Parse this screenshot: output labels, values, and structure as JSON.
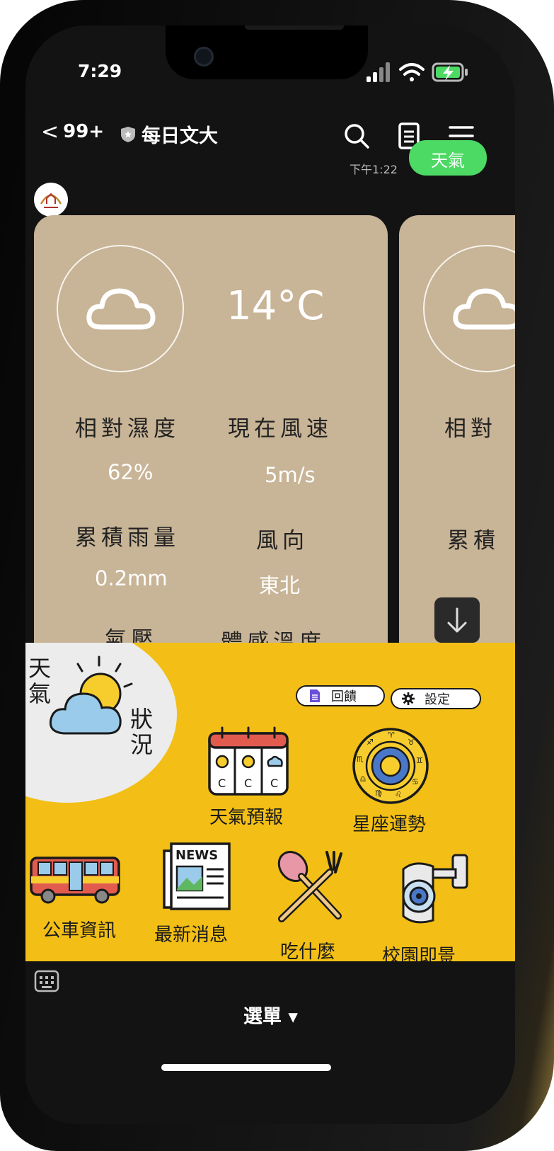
{
  "status_bar": {
    "time": "7:29"
  },
  "header": {
    "unread_count": "99+",
    "chat_title": "每日文大",
    "icons": [
      "chevron-left-icon",
      "shield-icon",
      "search-icon",
      "notes-icon",
      "hamburger-menu-icon"
    ]
  },
  "chat": {
    "last_message_time": "下午1:22",
    "sent_bubble_text": "天氣"
  },
  "weather_card": {
    "condition_icon": "cloud-icon",
    "temperature": "14°C",
    "humidity_label": "相對濕度",
    "humidity_value": "62%",
    "wind_speed_label": "現在風速",
    "wind_speed_value": "5m/s",
    "rainfall_label": "累積雨量",
    "rainfall_value": "0.2mm",
    "wind_dir_label": "風向",
    "wind_dir_value": "東北",
    "pressure_label": "氣壓",
    "feels_like_label": "體感溫度"
  },
  "weather_card_peek": {
    "humidity_label": "相對",
    "rainfall_label": "累積"
  },
  "menu": {
    "status_circle": {
      "top_left": "天氣",
      "right": "狀況"
    },
    "feedback_label": "回饋",
    "settings_label": "設定",
    "items": [
      {
        "label": "天氣預報",
        "icon": "calendar-weather-icon"
      },
      {
        "label": "星座運勢",
        "icon": "zodiac-wheel-icon"
      },
      {
        "label": "公車資訊",
        "icon": "bus-icon"
      },
      {
        "label": "最新消息",
        "icon": "newspaper-icon"
      },
      {
        "label": "吃什麼",
        "icon": "spoon-fork-icon"
      },
      {
        "label": "校園即景",
        "icon": "security-camera-icon"
      }
    ],
    "toggle_label": "選單 ▾"
  },
  "colors": {
    "card": "#c8b496",
    "menu_background": "#f3bf16",
    "bubble": "#4cd964",
    "screen_background": "#131313"
  }
}
